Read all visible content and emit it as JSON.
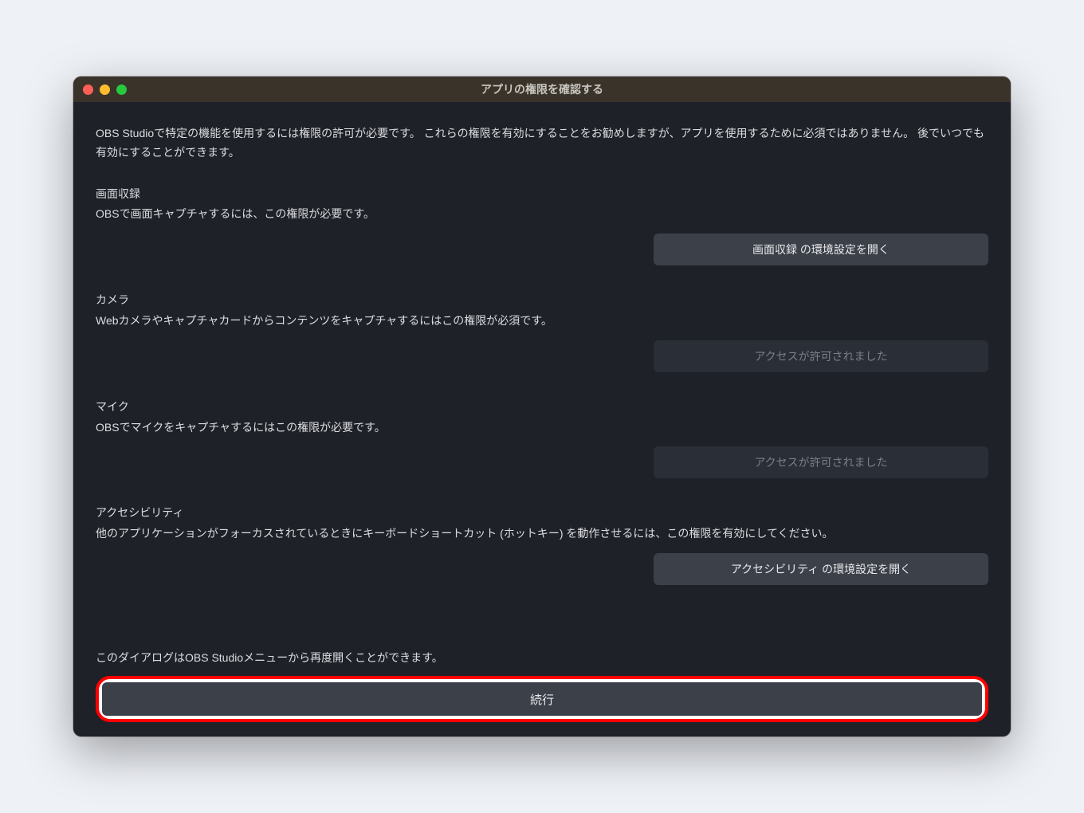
{
  "window": {
    "title": "アプリの権限を確認する"
  },
  "intro": "OBS Studioで特定の機能を使用するには権限の許可が必要です。 これらの権限を有効にすることをお勧めしますが、アプリを使用するために必須ではありません。 後でいつでも有効にすることができます。",
  "sections": {
    "screen_recording": {
      "title": "画面収録",
      "desc": "OBSで画面キャプチャするには、この権限が必要です。",
      "button": "画面収録 の環境設定を開く"
    },
    "camera": {
      "title": "カメラ",
      "desc": "Webカメラやキャプチャカードからコンテンツをキャプチャするにはこの権限が必須です。",
      "button": "アクセスが許可されました"
    },
    "microphone": {
      "title": "マイク",
      "desc": "OBSでマイクをキャプチャするにはこの権限が必要です。",
      "button": "アクセスが許可されました"
    },
    "accessibility": {
      "title": "アクセシビリティ",
      "desc": "他のアプリケーションがフォーカスされているときにキーボードショートカット (ホットキー) を動作させるには、この権限を有効にしてください。",
      "button": "アクセシビリティ の環境設定を開く"
    }
  },
  "footer_note": "このダイアログはOBS Studioメニューから再度開くことができます。",
  "continue_label": "続行"
}
